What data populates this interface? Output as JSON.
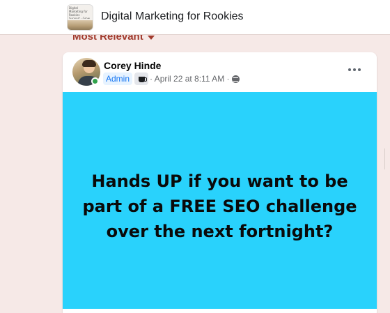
{
  "header": {
    "group_title": "Digital Marketing for Rookies",
    "thumbnail_text": "Digital Marketing for Rookies · Support · Grow your business online"
  },
  "feed": {
    "sort_label": "Most Relevant"
  },
  "post": {
    "author": "Corey Hinde",
    "role_badge": "Admin",
    "timestamp": "· April 22 at 8:11 AM ·",
    "privacy": "globe-icon",
    "image_text": "Hands UP if you want to be part of a FREE SEO challenge over the next fortnight?",
    "image_background": "#29d2fc"
  },
  "colors": {
    "page_background": "#f6e9e7",
    "accent": "#a13a2d",
    "admin_blue": "#1877f2",
    "online_green": "#31a24c"
  }
}
